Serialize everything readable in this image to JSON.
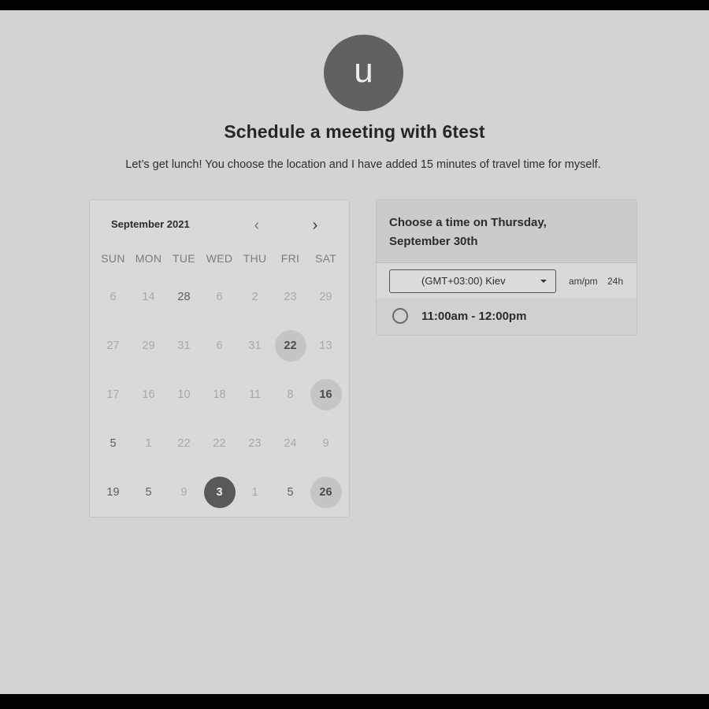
{
  "avatar": {
    "initial": "u"
  },
  "header": {
    "title": "Schedule a meeting with 6test",
    "subtitle": "Let’s get lunch! You choose the location and I have added 15 minutes of travel time for myself."
  },
  "calendar": {
    "month_label": "September 2021",
    "prev_icon": "‹",
    "next_icon": "›",
    "weekdays": [
      "SUN",
      "MON",
      "TUE",
      "WED",
      "THU",
      "FRI",
      "SAT"
    ],
    "weeks": [
      [
        {
          "label": "6"
        },
        {
          "label": "14"
        },
        {
          "label": "28",
          "strong": true
        },
        {
          "label": "6"
        },
        {
          "label": "2"
        },
        {
          "label": "23"
        },
        {
          "label": "29"
        }
      ],
      [
        {
          "label": "27"
        },
        {
          "label": "29"
        },
        {
          "label": "31"
        },
        {
          "label": "6"
        },
        {
          "label": "31"
        },
        {
          "label": "22",
          "available": true
        },
        {
          "label": "13"
        }
      ],
      [
        {
          "label": "17"
        },
        {
          "label": "16"
        },
        {
          "label": "10"
        },
        {
          "label": "18"
        },
        {
          "label": "11"
        },
        {
          "label": "8"
        },
        {
          "label": "16",
          "available": true
        }
      ],
      [
        {
          "label": "5",
          "strong": true
        },
        {
          "label": "1"
        },
        {
          "label": "22"
        },
        {
          "label": "22"
        },
        {
          "label": "23"
        },
        {
          "label": "24"
        },
        {
          "label": "9"
        }
      ],
      [
        {
          "label": "19",
          "strong": true
        },
        {
          "label": "5",
          "strong": true
        },
        {
          "label": "9"
        },
        {
          "label": "3",
          "selected": true
        },
        {
          "label": "1"
        },
        {
          "label": "5",
          "strong": true
        },
        {
          "label": "26",
          "available": true
        }
      ]
    ]
  },
  "time_panel": {
    "heading_line1": "Choose a time on Thursday,",
    "heading_line2": "September 30th",
    "timezone": "(GMT+03:00) Kiev",
    "format_ampm": "am/pm",
    "format_24": "24h",
    "slots": [
      {
        "label": "11:00am - 12:00pm"
      }
    ]
  },
  "colors": {
    "background": "#d3d3d3",
    "avatar": "#616161",
    "selected_day": "#595959",
    "available_day": "#c5c5c5"
  }
}
